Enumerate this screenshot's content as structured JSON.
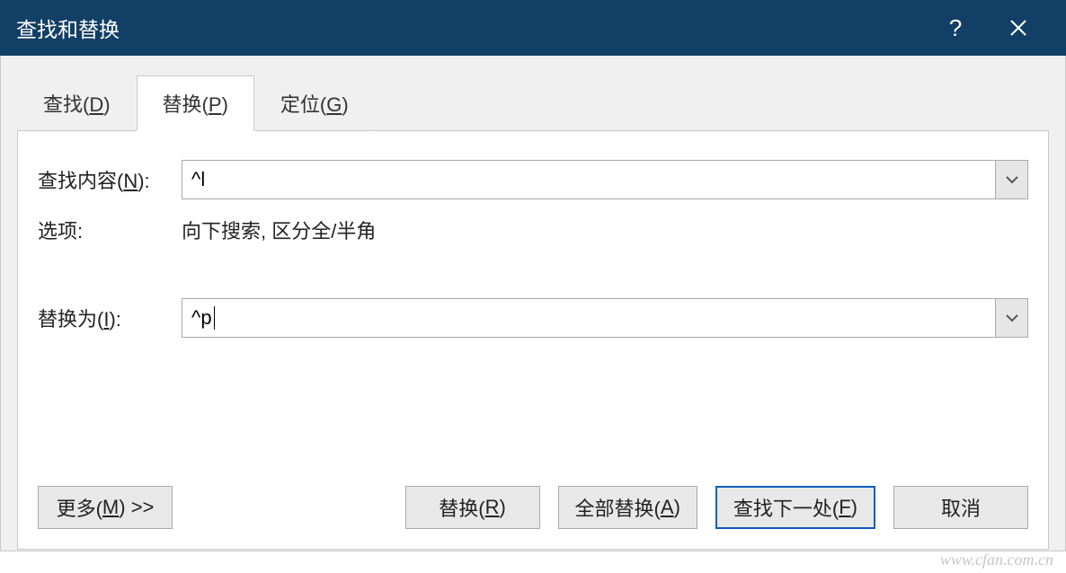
{
  "titlebar": {
    "title": "查找和替换",
    "help_label": "?",
    "close_label": "×"
  },
  "tabs": {
    "find": {
      "prefix": "查找(",
      "accel": "D",
      "suffix": ")"
    },
    "replace": {
      "prefix": "替换(",
      "accel": "P",
      "suffix": ")"
    },
    "goto": {
      "prefix": "定位(",
      "accel": "G",
      "suffix": ")"
    }
  },
  "fields": {
    "find_label_prefix": "查找内容(",
    "find_label_accel": "N",
    "find_label_suffix": "):",
    "find_value": "^l",
    "options_label": "选项:",
    "options_value": "向下搜索, 区分全/半角",
    "replace_label_prefix": "替换为(",
    "replace_label_accel": "I",
    "replace_label_suffix": "):",
    "replace_value": "^p"
  },
  "buttons": {
    "more": {
      "prefix": "更多(",
      "accel": "M",
      "suffix": ") >>"
    },
    "replace": {
      "prefix": "替换(",
      "accel": "R",
      "suffix": ")"
    },
    "replace_all": {
      "prefix": "全部替换(",
      "accel": "A",
      "suffix": ")"
    },
    "find_next": {
      "prefix": "查找下一处(",
      "accel": "F",
      "suffix": ")"
    },
    "cancel": {
      "label": "取消"
    }
  },
  "watermark": "www.cfan.com.cn"
}
